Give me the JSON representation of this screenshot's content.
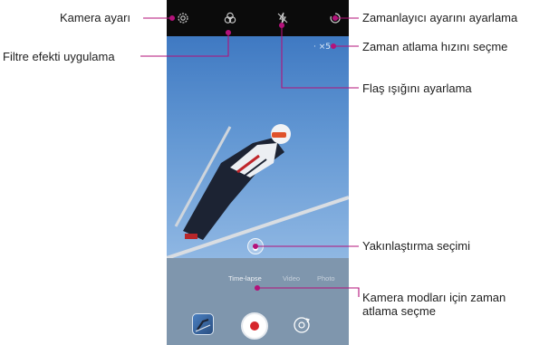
{
  "callouts": {
    "camera_settings": "Kamera ayarı",
    "apply_filter": "Filtre efekti uygulama",
    "timer": "Zamanlayıcı ayarını ayarlama",
    "timelapse_speed": "Zaman atlama hızını seçme",
    "flash": "Flaş ışığını ayarlama",
    "zoom": "Yakınlaştırma seçimi",
    "camera_modes": "Kamera modları için zaman atlama seçme"
  },
  "camera": {
    "speed_indicator": "· ×5",
    "modes": [
      "Time-lapse",
      "Video",
      "Photo"
    ],
    "active_mode": "Time-lapse",
    "icons": {
      "settings": "gear-icon",
      "filter": "filter-icon",
      "flash": "flash-off-icon",
      "timer": "timer-icon",
      "zoom": "zoom-icon",
      "gallery": "gallery-thumbnail-icon",
      "record": "record-icon",
      "switch": "switch-camera-icon"
    },
    "colors": {
      "topbar": "#0b0b0b",
      "sky": "#5e8fc9",
      "record": "#d6262b",
      "callout_line": "#b3127a"
    }
  }
}
